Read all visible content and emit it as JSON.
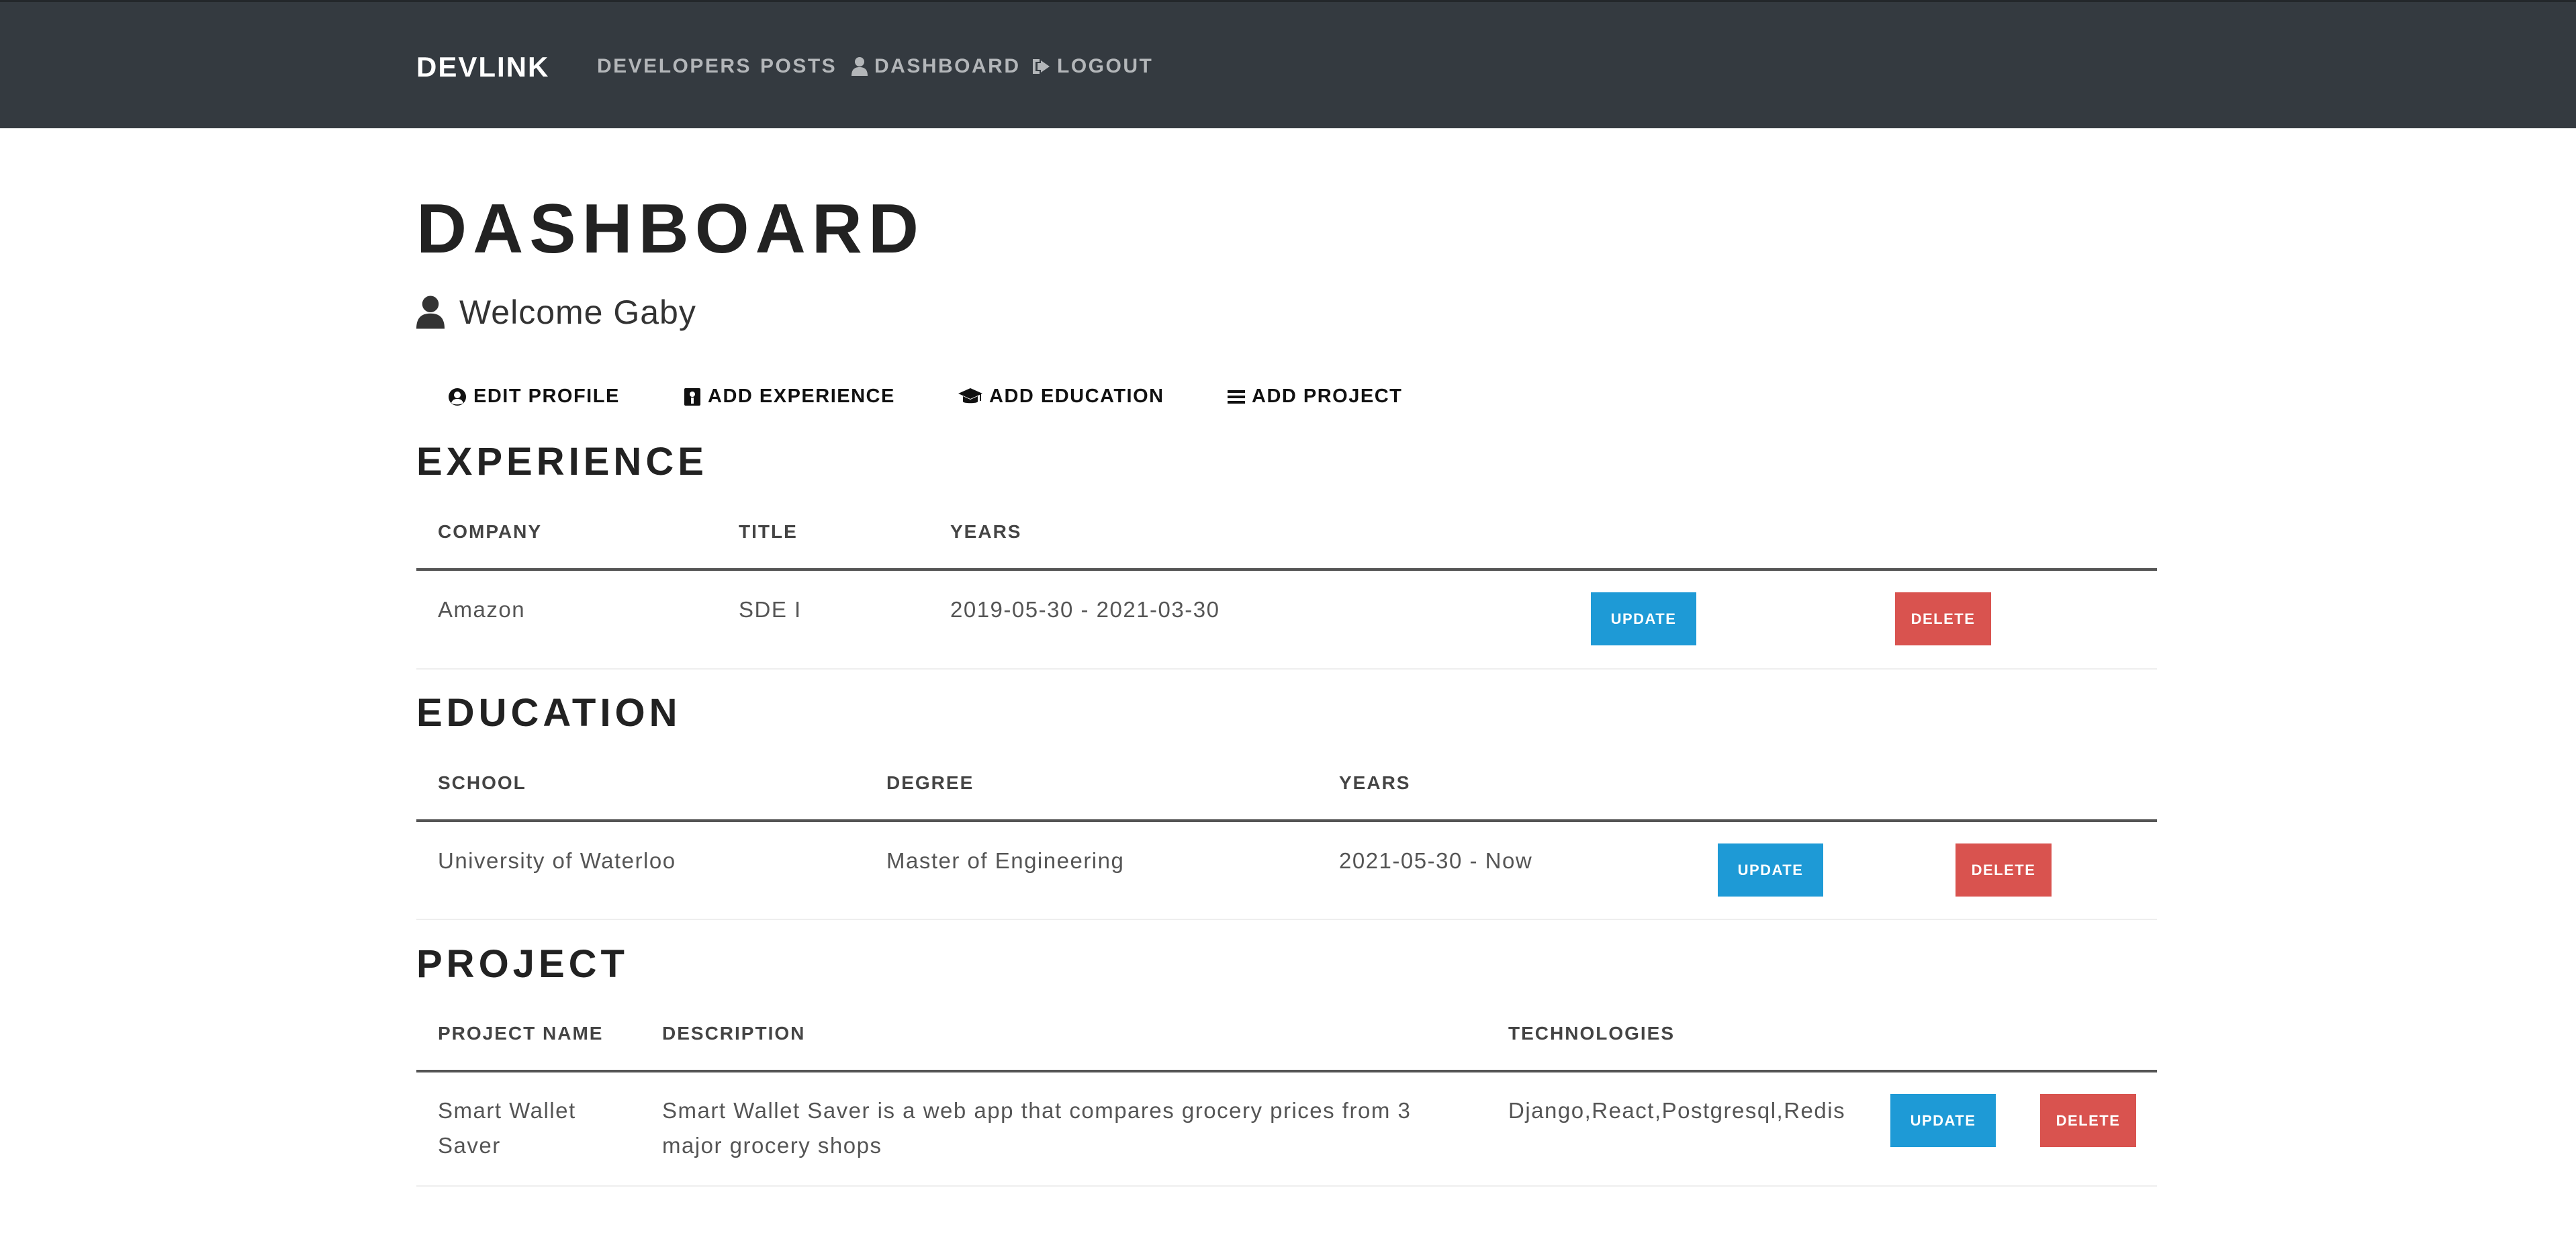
{
  "navbar": {
    "brand": "DEVLINK",
    "links": {
      "developers": "DEVELOPERS",
      "posts": "POSTS",
      "dashboard": "DASHBOARD",
      "logout": "LOGOUT"
    }
  },
  "main": {
    "title": "DASHBOARD",
    "welcome": "Welcome Gaby",
    "actions": {
      "edit_profile": "EDIT PROFILE",
      "add_experience": "ADD EXPERIENCE",
      "add_education": "ADD EDUCATION",
      "add_project": "ADD PROJECT"
    }
  },
  "experience": {
    "title": "EXPERIENCE",
    "headers": [
      "COMPANY",
      "TITLE",
      "YEARS"
    ],
    "rows": [
      {
        "company": "Amazon",
        "title": "SDE I",
        "years": "2019-05-30 - 2021-03-30",
        "update": "UPDATE",
        "delete": "DELETE"
      }
    ]
  },
  "education": {
    "title": "EDUCATION",
    "headers": [
      "SCHOOL",
      "DEGREE",
      "YEARS"
    ],
    "rows": [
      {
        "school": "University of Waterloo",
        "degree": "Master of Engineering",
        "years": "2021-05-30 - Now",
        "update": "UPDATE",
        "delete": "DELETE"
      }
    ]
  },
  "project": {
    "title": "PROJECT",
    "headers": [
      "PROJECT NAME",
      "DESCRIPTION",
      "TECHNOLOGIES"
    ],
    "rows": [
      {
        "name_line1": "Smart Wallet",
        "name_line2": "Saver",
        "description_line1": "Smart Wallet Saver is a web app that compares grocery prices from 3",
        "description_line2": "major grocery shops",
        "technologies": "Django,React,Postgresql,Redis",
        "update": "UPDATE",
        "delete": "DELETE"
      }
    ]
  },
  "colors": {
    "navbar_bg": "#343a40",
    "update_btn": "#1e9ad6",
    "delete_btn": "#d9534f"
  },
  "icons": {
    "dashboard": "user-icon",
    "logout": "sign-out-icon",
    "welcome": "user-icon",
    "edit_profile": "user-circle-icon",
    "add_experience": "id-badge-icon",
    "add_education": "graduation-cap-icon",
    "add_project": "list-icon"
  }
}
